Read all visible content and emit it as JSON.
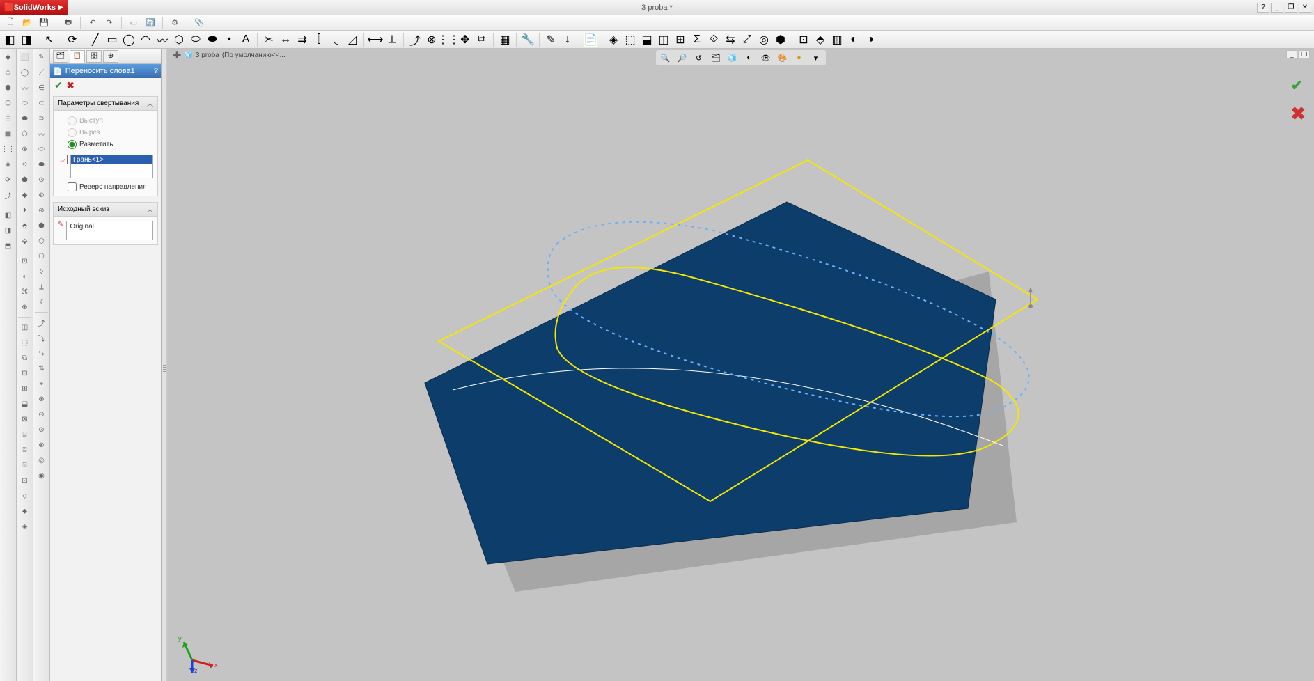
{
  "app": {
    "brand": "SolidWorks",
    "doc_title": "3 proba *"
  },
  "titlebar_buttons": {
    "help": "?",
    "min": "_",
    "max": "❐",
    "close": "✕"
  },
  "subwin_buttons": {
    "min": "_",
    "max": "❐"
  },
  "crumb": {
    "pin": "📌",
    "name": "3 proba",
    "config": "(По умолчанию<<..."
  },
  "prop": {
    "feature_name": "Переносить слова1",
    "help": "?",
    "group1": {
      "title": "Параметры свертывания",
      "opt1": "Выступ",
      "opt2": "Вырез",
      "opt3": "Разметить",
      "selection": "Грань<1>",
      "reverse": "Реверс направления"
    },
    "group2": {
      "title": "Исходный эскиз",
      "value": "Original"
    }
  },
  "confirm": {
    "ok_glyph": "✔",
    "x_glyph": "✖"
  }
}
